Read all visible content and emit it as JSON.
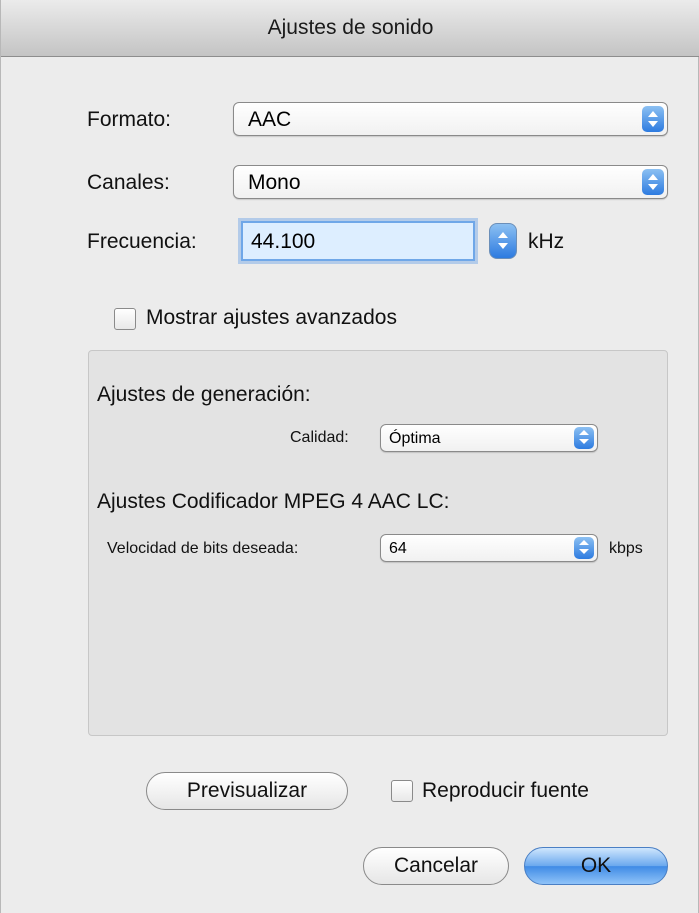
{
  "window": {
    "title": "Ajustes de sonido"
  },
  "format": {
    "label": "Formato:",
    "value": "AAC"
  },
  "channels": {
    "label": "Canales:",
    "value": "Mono"
  },
  "frequency": {
    "label": "Frecuencia:",
    "value": "44.100",
    "unit": "kHz"
  },
  "advanced": {
    "checkbox_label": "Mostrar ajustes avanzados",
    "checked": false
  },
  "generation": {
    "heading": "Ajustes de generación:",
    "quality_label": "Calidad:",
    "quality_value": "Óptima"
  },
  "encoder": {
    "heading": "Ajustes Codificador MPEG 4 AAC LC:",
    "bitrate_label": "Velocidad de bits deseada:",
    "bitrate_value": "64",
    "bitrate_unit": "kbps"
  },
  "buttons": {
    "preview": "Previsualizar",
    "play_source": "Reproducir fuente",
    "cancel": "Cancelar",
    "ok": "OK"
  },
  "colors": {
    "accent": "#2d7be0",
    "background": "#ececec"
  }
}
